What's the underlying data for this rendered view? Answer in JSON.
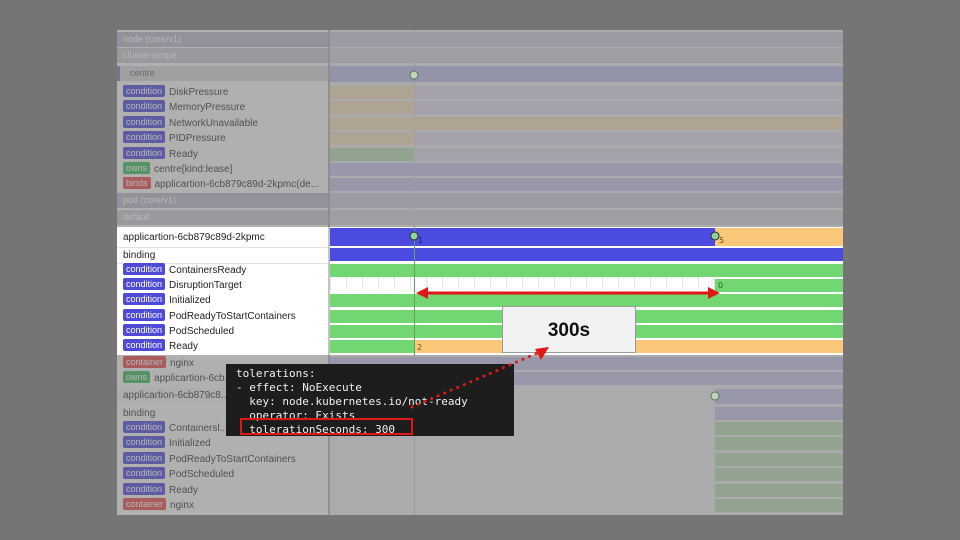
{
  "colors": {
    "blue": "#4b4be0",
    "orange": "#f8c77a",
    "green": "#72d672",
    "purple": "#4d4bd6",
    "red": "#e01818",
    "gray": "#bdbdbd"
  },
  "background": {
    "node_header": "node (core/v1)",
    "scope": "cluster-scope",
    "node_name": "centre",
    "node_conditions": [
      "DiskPressure",
      "MemoryPressure",
      "NetworkUnavailable",
      "PIDPressure",
      "Ready"
    ],
    "condition_badge": "condition",
    "owns_badge": "owns",
    "owns_value": "centre[kind:lease]",
    "binds_badge": "binds",
    "binds_value": "applicartion-6cb879c89d-2kpmc(de...",
    "pod_header": "pod (core/v1)",
    "namespace": "default",
    "container_badge": "container",
    "container_value": "nginx",
    "owns_value_2": "applicartion-6cb...",
    "pod_name_2": "applicartion-6cb879c8...",
    "binding_2": "binding",
    "conditions_2": [
      "Containersl...",
      "Initialized",
      "PodReadyToStartContainers",
      "PodScheduled",
      "Ready"
    ],
    "container_value_2": "nginx"
  },
  "focus": {
    "pod_name": "applicartion-6cb879c89d-2kpmc",
    "binding": "binding",
    "condition_badge": "condition",
    "conditions": [
      "ContainersReady",
      "DisruptionTarget",
      "Initialized",
      "PodReadyToStartContainers",
      "PodScheduled",
      "Ready"
    ],
    "marker_left": "1",
    "marker_right": "5",
    "disruption_value": "0",
    "ready_value": "2"
  },
  "callout": {
    "label": "300s"
  },
  "code": {
    "lines": [
      "tolerations:",
      "- effect: NoExecute",
      "  key: node.kubernetes.io/not-ready",
      "  operator: Exists",
      "  tolerationSeconds: 300"
    ]
  }
}
